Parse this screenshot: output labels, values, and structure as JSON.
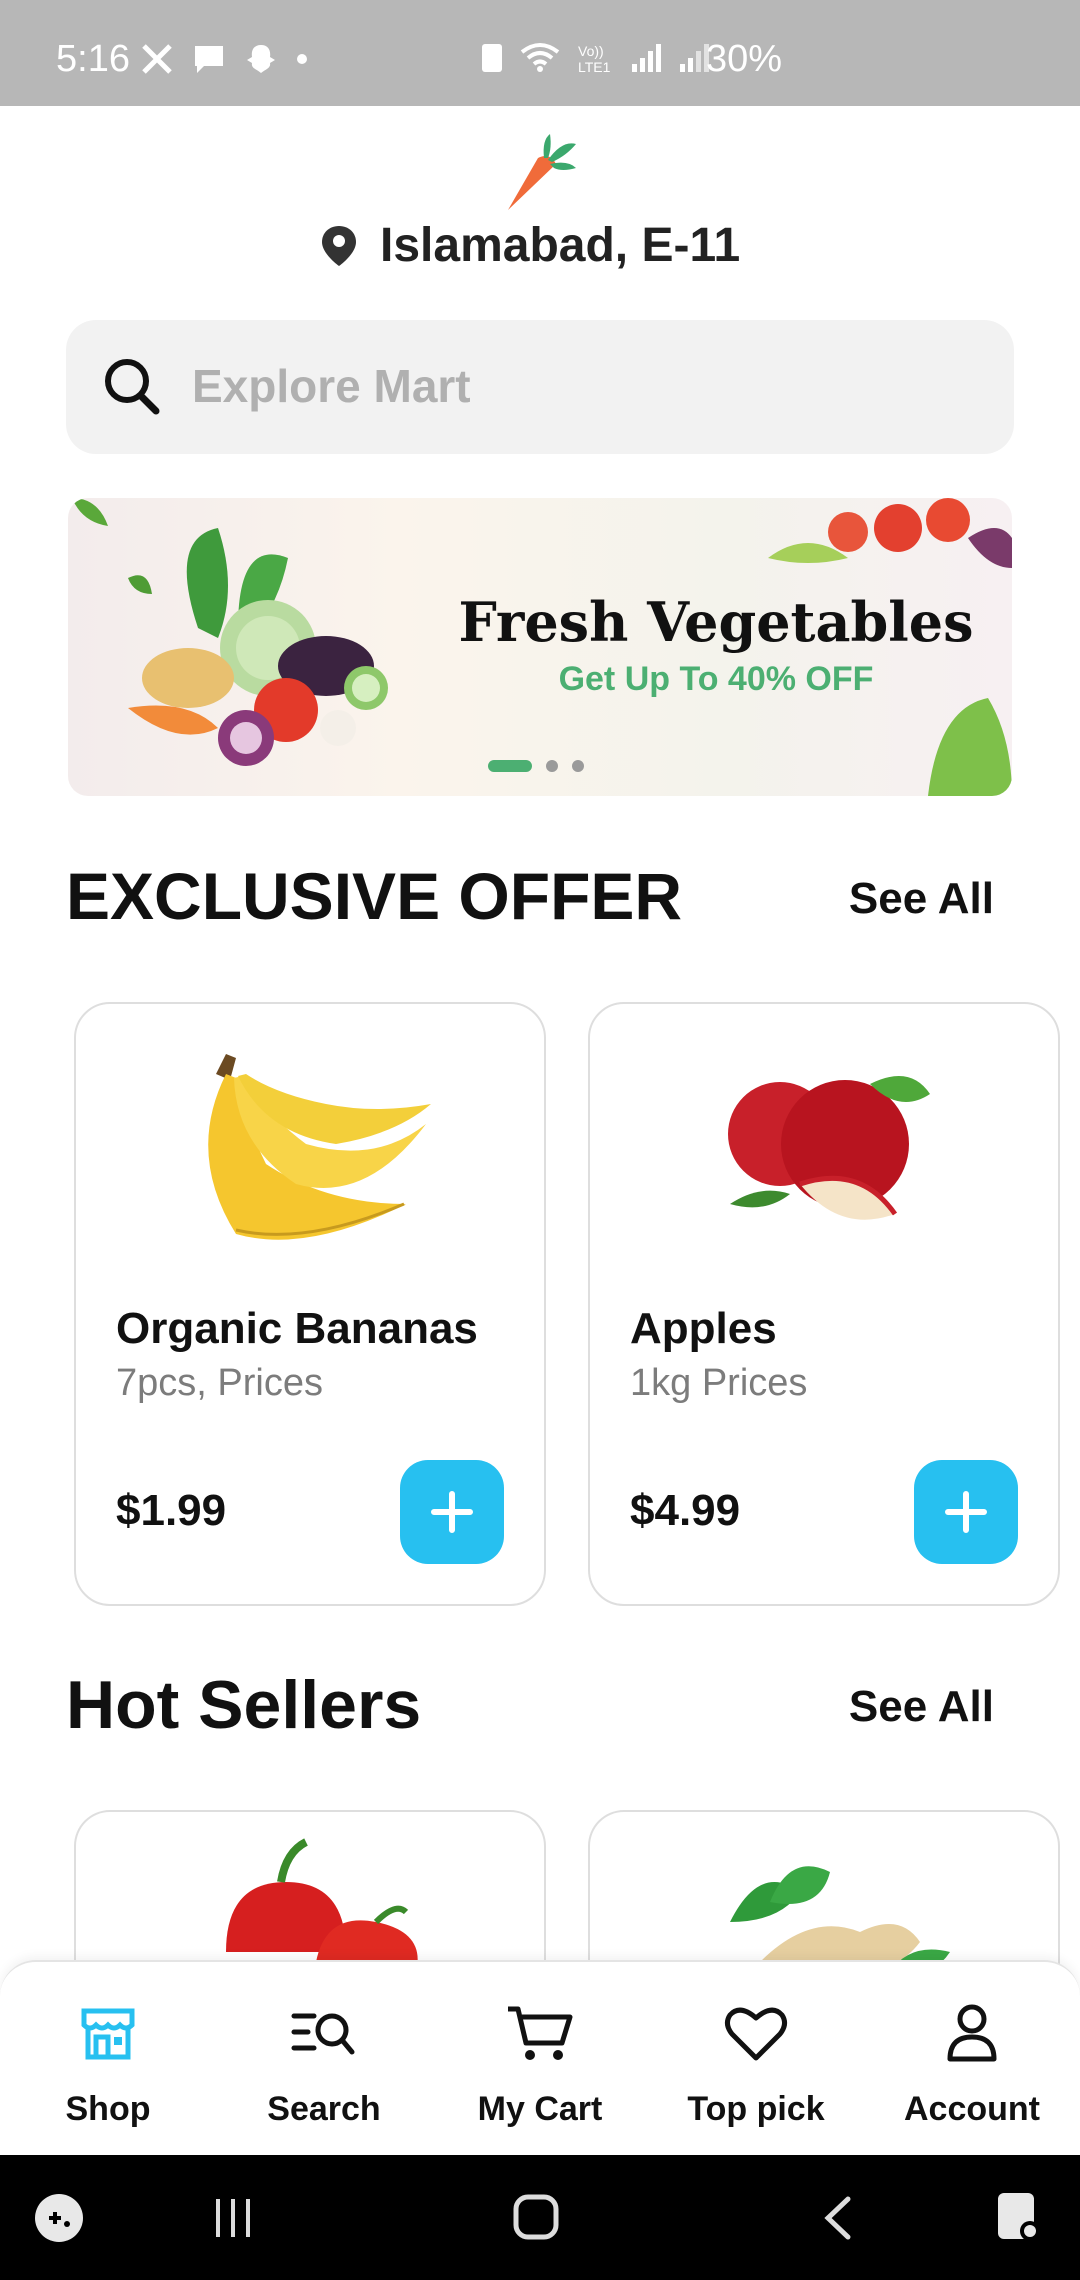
{
  "status_bar": {
    "time": "5:16",
    "battery": "30%"
  },
  "header": {
    "location": "Islamabad, E-11"
  },
  "search": {
    "placeholder": "Explore Mart"
  },
  "banner": {
    "title": "Fresh Vegetables",
    "subtitle": "Get Up To 40% OFF",
    "active_slide": 1,
    "slide_count": 3
  },
  "exclusive": {
    "title": "EXCLUSIVE OFFER",
    "see_all": "See All",
    "products": [
      {
        "name": "Organic Bananas",
        "desc": "7pcs, Prices",
        "price": "$1.99"
      },
      {
        "name": "Apples",
        "desc": "1kg Prices",
        "price": "$4.99"
      }
    ]
  },
  "hot_sellers": {
    "title": "Hot Sellers",
    "see_all": "See All"
  },
  "bottom_nav": {
    "items": [
      {
        "label": "Shop",
        "icon": "store-icon",
        "active": true
      },
      {
        "label": "Search",
        "icon": "search-list-icon",
        "active": false
      },
      {
        "label": "My Cart",
        "icon": "cart-icon",
        "active": false
      },
      {
        "label": "Top pick",
        "icon": "heart-icon",
        "active": false
      },
      {
        "label": "Account",
        "icon": "user-icon",
        "active": false
      }
    ]
  },
  "colors": {
    "accent_blue": "#27c0f0",
    "accent_green": "#4caf72",
    "status_bar": "#b7b7b7"
  }
}
